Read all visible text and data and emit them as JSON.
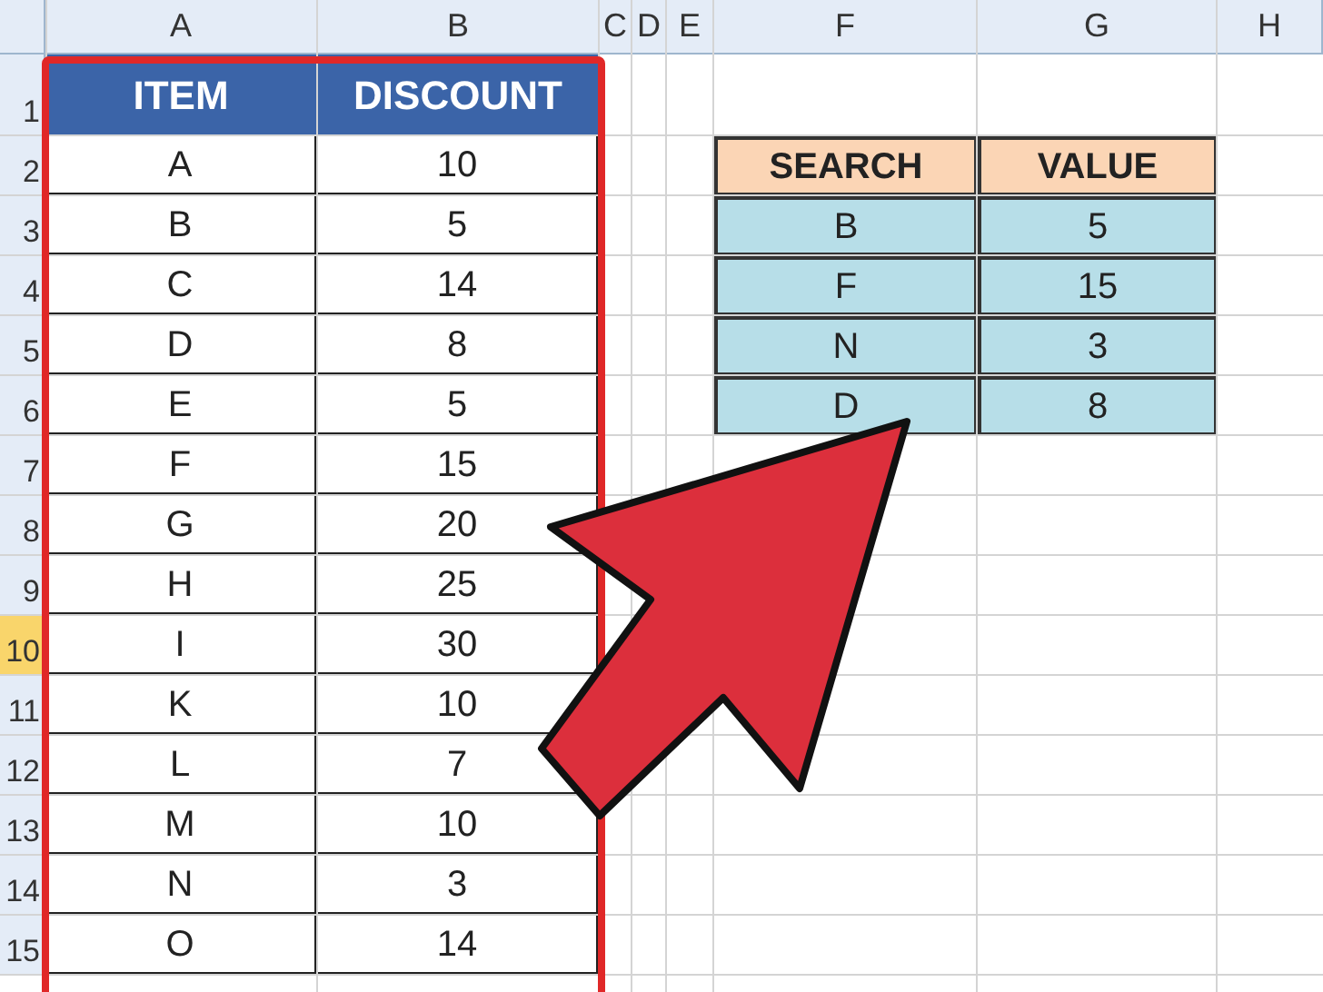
{
  "column_headers": [
    "A",
    "B",
    "C",
    "D",
    "E",
    "F",
    "G",
    "H"
  ],
  "row_headers": [
    {
      "label": "1",
      "selected": false
    },
    {
      "label": "2",
      "selected": false
    },
    {
      "label": "3",
      "selected": false
    },
    {
      "label": "4",
      "selected": false
    },
    {
      "label": "5",
      "selected": false
    },
    {
      "label": "6",
      "selected": false
    },
    {
      "label": "7",
      "selected": false
    },
    {
      "label": "8",
      "selected": false
    },
    {
      "label": "9",
      "selected": false
    },
    {
      "label": "10",
      "selected": true
    },
    {
      "label": "11",
      "selected": false
    },
    {
      "label": "12",
      "selected": false
    },
    {
      "label": "13",
      "selected": false
    },
    {
      "label": "14",
      "selected": false
    },
    {
      "label": "15",
      "selected": false
    }
  ],
  "discount_table": {
    "columns": [
      "ITEM",
      "DISCOUNT"
    ],
    "rows": [
      [
        "A",
        "10"
      ],
      [
        "B",
        "5"
      ],
      [
        "C",
        "14"
      ],
      [
        "D",
        "8"
      ],
      [
        "E",
        "5"
      ],
      [
        "F",
        "15"
      ],
      [
        "G",
        "20"
      ],
      [
        "H",
        "25"
      ],
      [
        "I",
        "30"
      ],
      [
        "K",
        "10"
      ],
      [
        "L",
        "7"
      ],
      [
        "M",
        "10"
      ],
      [
        "N",
        "3"
      ],
      [
        "O",
        "14"
      ]
    ]
  },
  "lookup_table": {
    "columns": [
      "SEARCH",
      "VALUE"
    ],
    "rows": [
      [
        "B",
        "5"
      ],
      [
        "F",
        "15"
      ],
      [
        "N",
        "3"
      ],
      [
        "D",
        "8"
      ]
    ]
  }
}
